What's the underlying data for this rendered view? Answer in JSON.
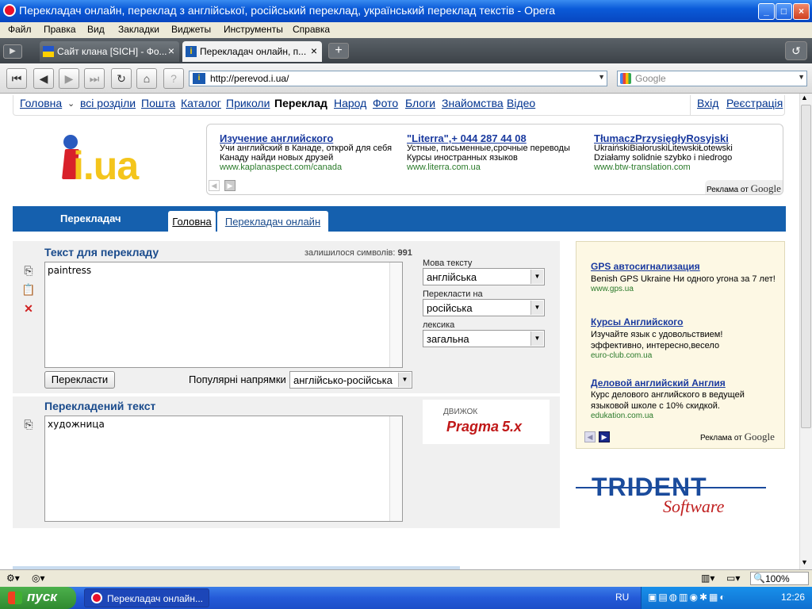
{
  "window": {
    "title": "Перекладач онлайн, переклад з англійської, російський переклад, український переклад текстів - Opera",
    "controls": [
      "_",
      "□",
      "×"
    ]
  },
  "menubar": [
    "Файл",
    "Правка",
    "Вид",
    "Закладки",
    "Виджеты",
    "Инструменты",
    "Справка"
  ],
  "tabs": [
    {
      "label": "Сайт клана [SICH] - Фо...",
      "close": "×"
    },
    {
      "label": "Перекладач онлайн, п...",
      "close": "×"
    }
  ],
  "navbar": {
    "url": "http://perevod.i.ua/",
    "search_placeholder": "Google"
  },
  "site_nav": {
    "items": [
      "Головна",
      "всі розділи",
      "Пошта",
      "Каталог",
      "Приколи",
      "Переклад",
      "Народ",
      "Фото",
      "Блоги",
      "Знайомства",
      "Відео"
    ],
    "login": "Вхід",
    "register": "Реєстрація"
  },
  "logo": {
    "text": "i.ua"
  },
  "top_ads": [
    {
      "title": "Изучение английского",
      "desc": "Учи английский в Канаде, открой для себя Канаду найди новых друзей",
      "url": "www.kaplanaspect.com/canada"
    },
    {
      "title": "\"Literra\",+ 044 287 44 08",
      "desc": "Устные, письменные,срочные переводы Курсы иностранных языков",
      "url": "www.literra.com.ua"
    },
    {
      "title": "TłumaczPrzysięgłyRosyjski",
      "desc": "UkraińskiBiałoruskiLitewskiŁotewski Działamy solidnie szybko i niedrogo",
      "url": "www.btw-translation.com"
    }
  ],
  "ads_by": "Реклама от",
  "google": "Google",
  "section": {
    "title": "Перекладач",
    "tabs": [
      "Головна",
      "Перекладач онлайн"
    ]
  },
  "translator": {
    "source_heading": "Текст для перекладу",
    "chars_left_label": "залишилося символів:",
    "chars_left": "991",
    "source_text": "paintress",
    "source_lang_label": "Мова тексту",
    "source_lang": "англійська",
    "target_lang_label": "Перекласти на",
    "target_lang": "російська",
    "lexicon_label": "лексика",
    "lexicon": "загальна",
    "translate_button": "Перекласти",
    "popular_label": "Популярні напрямки",
    "popular_value": "англійсько-російська",
    "result_heading": "Перекладений текст",
    "result_text": "художница",
    "engine_label": "ДВИЖОК",
    "engine_name": "Pragma",
    "engine_version": "5.x"
  },
  "right_ads": [
    {
      "title": "GPS автосигнализация",
      "desc": "Benish GPS Ukraine Ни одного угона за 7 лет!",
      "url": "www.gps.ua"
    },
    {
      "title": "Курсы Английского",
      "desc": "Изучайте язык с удовольствием! эффективно, интересно,весело",
      "url": "euro-club.com.ua"
    },
    {
      "title": "Деловой английский Англия",
      "desc": "Курс делового английского в ведущей языковой школе с 10% скидкой.",
      "url": "edukation.com.ua"
    }
  ],
  "trident": {
    "name": "TRIDENT",
    "sub": "Software"
  },
  "statusbar": {
    "zoom": "100%"
  },
  "taskbar": {
    "start": "пуск",
    "item": "Перекладач онлайн...",
    "lang": "RU",
    "time": "12:26"
  },
  "colors": {
    "accent": "#1560ae",
    "link": "#00338f",
    "title_bar": "#0a5ad8"
  }
}
